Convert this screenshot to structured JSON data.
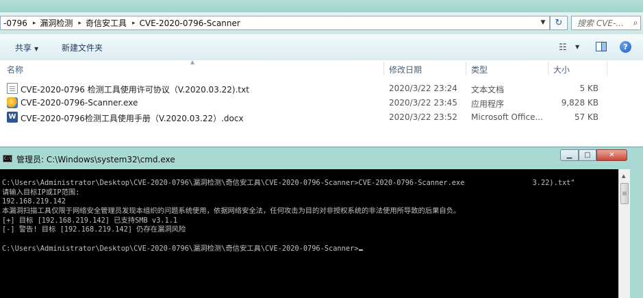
{
  "explorer": {
    "breadcrumbs": [
      "-0796",
      "漏洞检测",
      "奇信安工具",
      "CVE-2020-0796-Scanner"
    ],
    "search_placeholder": "搜索 CVE-...",
    "toolbar": {
      "share_label": "共享",
      "new_folder_label": "新建文件夹"
    },
    "columns": {
      "name": "名称",
      "date": "修改日期",
      "type": "类型",
      "size": "大小"
    },
    "files": [
      {
        "name": "CVE-2020-0796 检测工具使用许可协议（V.2020.03.22).txt",
        "date": "2020/3/22 23:24",
        "type": "文本文档",
        "size": "5 KB",
        "icon": "text-file-icon"
      },
      {
        "name": "CVE-2020-0796-Scanner.exe",
        "date": "2020/3/22 23:45",
        "type": "应用程序",
        "size": "9,828 KB",
        "icon": "exe-file-icon"
      },
      {
        "name": "CVE-2020-0796检测工具使用手册（V.2020.03.22）.docx",
        "date": "2020/3/22 23:52",
        "type": "Microsoft Office...",
        "size": "57 KB",
        "icon": "word-doc-icon"
      }
    ]
  },
  "cmd": {
    "title": "管理员: C:\\Windows\\system32\\cmd.exe",
    "lines": [
      "C:\\Users\\Administrator\\Desktop\\CVE-2020-0796\\漏洞检测\\奇信安工具\\CVE-2020-0796-Scanner>CVE-2020-0796-Scanner.exe                3.22).txt\"",
      "请输入目标IP或IP范围:",
      "192.168.219.142",
      "本漏洞扫描工具仅限于网络安全管理员发现本组织的问题系统使用，依据网络安全法，任何攻击为目的对非授权系统的非法使用所导致的后果自负。",
      "[+] 目标 [192.168.219.142] 已支持SMB v3.1.1",
      "[-] 警告! 目标 [192.168.219.142] 仍存在漏洞风险",
      "",
      "C:\\Users\\Administrator\\Desktop\\CVE-2020-0796\\漏洞检测\\奇信安工具\\CVE-2020-0796-Scanner>"
    ]
  }
}
